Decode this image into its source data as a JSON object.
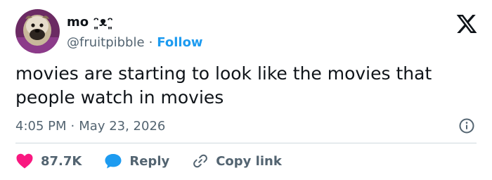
{
  "author": {
    "display_name": "mo ᵔ͈ᴥᵔ͈",
    "handle": "@fruitpibble",
    "separator": "·",
    "follow_label": "Follow"
  },
  "tweet": {
    "text": "movies are starting to look like the movies that people watch in movies",
    "time": "4:05 PM",
    "date": "May 23, 2026"
  },
  "actions": {
    "likes_count": "87.7K",
    "reply_label": "Reply",
    "copy_link_label": "Copy link"
  },
  "colors": {
    "accent": "#1d9bf0",
    "like": "#f91880",
    "text": "#0f1419",
    "muted": "#536471",
    "divider": "#cfd9de"
  },
  "icons": {
    "brand": "x-logo-icon",
    "info": "info-icon",
    "like": "heart-icon",
    "reply": "speech-bubble-icon",
    "copy_link": "link-icon"
  }
}
